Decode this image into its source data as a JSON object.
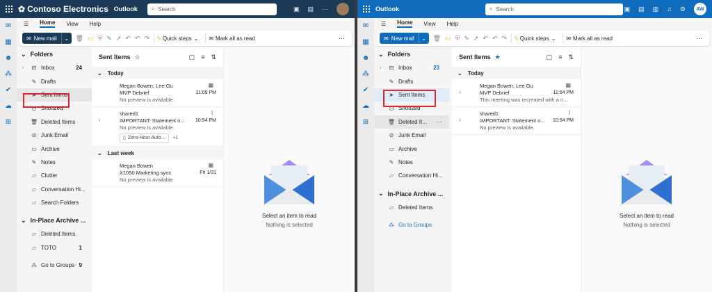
{
  "left": {
    "topbar": {
      "brand": "Contoso Electronics",
      "app": "Outlook",
      "search_placeholder": "Search"
    },
    "tabs": [
      "Home",
      "View",
      "Help"
    ],
    "ribbon": {
      "new_mail": "New mail",
      "quick_steps": "Quick steps",
      "mark_all_read": "Mark all as read"
    },
    "folders": {
      "header": "Folders",
      "items": [
        {
          "label": "Inbox",
          "count": "24",
          "icon": "inbox-icon"
        },
        {
          "label": "Drafts",
          "count": "",
          "icon": "drafts-icon"
        },
        {
          "label": "Sent Items",
          "count": "",
          "icon": "send-icon"
        },
        {
          "label": "Snoozed",
          "count": "",
          "icon": "clock-icon"
        },
        {
          "label": "Deleted Items",
          "count": "",
          "icon": "trash-icon"
        },
        {
          "label": "Junk Email",
          "count": "",
          "icon": "junk-icon"
        },
        {
          "label": "Archive",
          "count": "",
          "icon": "archive-icon"
        },
        {
          "label": "Notes",
          "count": "",
          "icon": "notes-icon"
        },
        {
          "label": "Clutter",
          "count": "",
          "icon": "folder-icon"
        },
        {
          "label": "Conversation Hi...",
          "count": "",
          "icon": "folder-icon"
        },
        {
          "label": "Search Folders",
          "count": "",
          "icon": "search-folder-icon"
        }
      ],
      "archive_header": "In-Place Archive ...",
      "archive_items": [
        {
          "label": "Deleted Items",
          "count": ""
        },
        {
          "label": "TOTO",
          "count": "1"
        }
      ],
      "goto_groups": {
        "label": "Go to Groups",
        "count": "9"
      }
    },
    "list": {
      "title": "Sent Items",
      "groups": [
        {
          "label": "Today",
          "messages": [
            {
              "from": "Megan Bowen; Lee Gu",
              "subject": "MVP Debrief",
              "preview": "No preview is available.",
              "time": "11:09 PM",
              "icon": "calendar-icon",
              "expand": false
            },
            {
              "from": "shared1",
              "subject": "IMPORTANT: Statement o...",
              "preview": "No preview is available.",
              "time": "10:54 PM",
              "icon": "paperclip-icon",
              "expand": true,
              "attachment": "Zero-Hour Auto...",
              "more": "+1"
            }
          ]
        },
        {
          "label": "Last week",
          "messages": [
            {
              "from": "Megan Bowen",
              "subject": "X1050 Marketing sync",
              "preview": "No preview is available.",
              "time": "Fri 1/31",
              "icon": "calendar-icon",
              "expand": false
            }
          ]
        }
      ]
    },
    "reading": {
      "title": "Select an item to read",
      "subtitle": "Nothing is selected"
    }
  },
  "right": {
    "topbar": {
      "app": "Outlook",
      "search_placeholder": "Search",
      "avatar": "AW"
    },
    "tabs": [
      "Home",
      "View",
      "Help"
    ],
    "ribbon": {
      "new_mail": "New mail",
      "quick_steps": "Quick steps",
      "mark_all_read": "Mark all as read"
    },
    "folders": {
      "header": "Folders",
      "items": [
        {
          "label": "Inbox",
          "count": "23",
          "icon": "inbox-icon"
        },
        {
          "label": "Drafts",
          "count": "",
          "icon": "drafts-icon"
        },
        {
          "label": "Sent Items",
          "count": "",
          "icon": "send-icon"
        },
        {
          "label": "Snoozed",
          "count": "",
          "icon": "clock-icon"
        },
        {
          "label": "Deleted It...",
          "count": "",
          "icon": "trash-icon"
        },
        {
          "label": "Junk Email",
          "count": "",
          "icon": "junk-icon"
        },
        {
          "label": "Archive",
          "count": "",
          "icon": "archive-icon"
        },
        {
          "label": "Notes",
          "count": "",
          "icon": "notes-icon"
        },
        {
          "label": "Conversation Hi...",
          "count": "",
          "icon": "folder-icon"
        }
      ],
      "archive_header": "In-Place Archive ...",
      "archive_items": [
        {
          "label": "Deleted Items",
          "count": ""
        }
      ],
      "goto_groups": {
        "label": "Go to Groups",
        "count": ""
      }
    },
    "list": {
      "title": "Sent Items",
      "groups": [
        {
          "label": "Today",
          "messages": [
            {
              "from": "Megan Bowen; Lee Gu",
              "subject": "MVP Debrief",
              "preview": "This meeting was recreated with a n...",
              "time": "11:54 PM",
              "icon": "calendar-icon",
              "expand": true
            },
            {
              "from": "shared1",
              "subject": "IMPORTANT: Statement o...",
              "preview": "No preview is available.",
              "time": "10:54 PM",
              "icon": "paperclip-icon",
              "expand": true
            }
          ]
        }
      ]
    },
    "reading": {
      "title": "Select an item to read",
      "subtitle": "Nothing is selected"
    }
  },
  "colors": {
    "left_header": "#1b3a57",
    "right_header": "#0f6cbd",
    "highlight": "#e0252f"
  }
}
